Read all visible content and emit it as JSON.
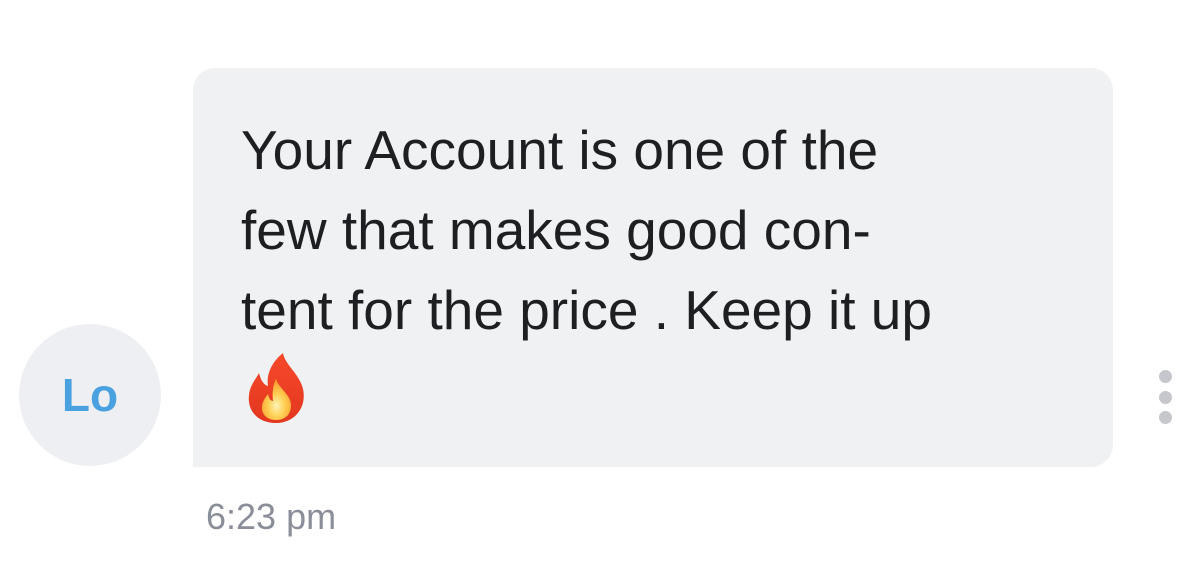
{
  "sender": {
    "initials": "Lo",
    "initials_color": "#4aa1e0",
    "avatar_bg": "#eeeff2"
  },
  "message": {
    "lines": [
      "Your Account is one of the",
      "few that makes good con-",
      "tent for the price . Keep it up"
    ],
    "emoji": "fire-icon",
    "bubble_bg": "#f0f1f3",
    "text_color": "#1e1f22"
  },
  "timestamp": "6:23 pm",
  "actions": {
    "more_icon": "more-vertical-icon"
  }
}
